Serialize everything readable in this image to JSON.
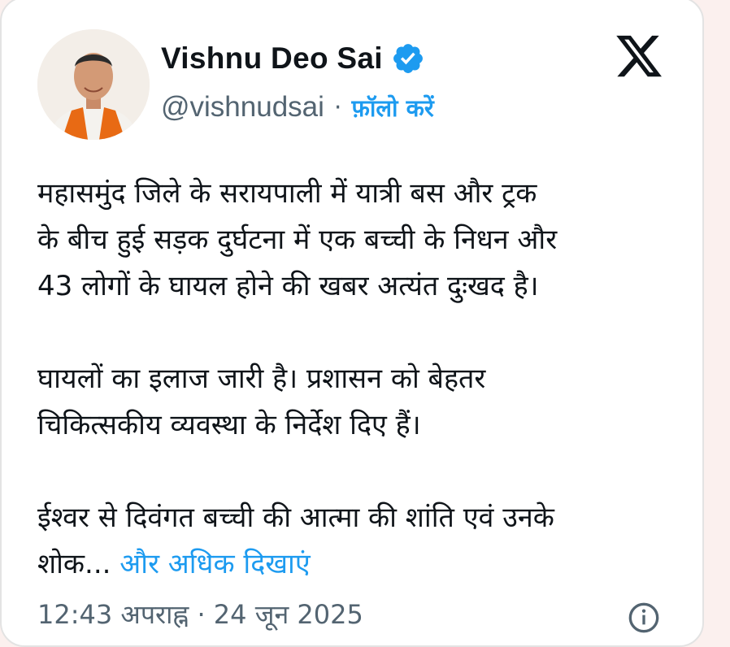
{
  "post": {
    "author_name": "Vishnu Deo Sai",
    "handle": "@vishnudsai",
    "separator": "·",
    "follow_label": "फ़ॉलो करें",
    "verified_icon": "verified-badge-icon",
    "platform_icon": "x-logo-icon",
    "paragraphs": [
      "महासमुंद जिले के सरायपाली में यात्री बस और ट्रक\nके बीच हुई सड़क दुर्घटना में एक बच्ची के निधन और\n43 लोगों के घायल होने की खबर अत्यंत दुःखद है।",
      "घायलों का इलाज जारी है। प्रशासन को बेहतर\nचिकित्सकीय व्यवस्था के निर्देश दिए हैं।"
    ],
    "last_paragraph": "ईश्वर से दिवंगत बच्ची की आत्मा की शांति एवं उनके\nशोक... ",
    "show_more_label": "और अधिक दिखाएं",
    "timestamp": "12:43 अपराह्न · 24 जून 2025"
  },
  "colors": {
    "link": "#1d9bf0",
    "text": "#0f1419",
    "secondary": "#536471",
    "background": "#fbf0ee",
    "card": "#ffffff"
  }
}
